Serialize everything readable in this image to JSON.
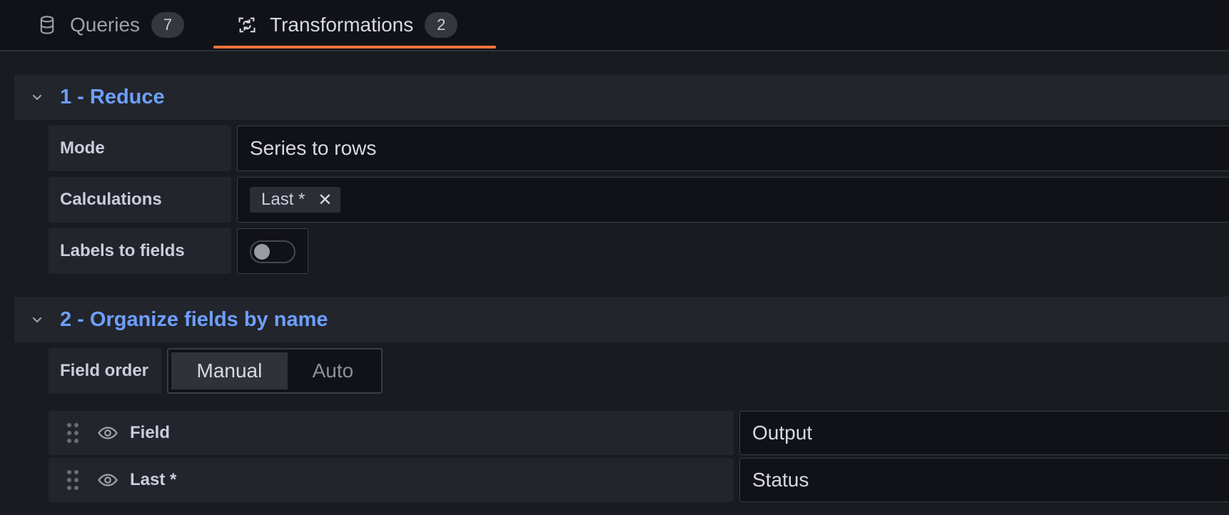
{
  "tabs": [
    {
      "label": "Queries",
      "count": "7",
      "icon": "database-icon"
    },
    {
      "label": "Transformations",
      "count": "2",
      "icon": "transform-icon"
    }
  ],
  "colors": {
    "accent": "#f5733a",
    "section_title": "#6e9fff"
  },
  "transforms": [
    {
      "title": "1 - Reduce",
      "fields": {
        "mode": {
          "label": "Mode",
          "value": "Series to rows"
        },
        "calculations": {
          "label": "Calculations",
          "chips": [
            "Last *"
          ]
        },
        "labels_to_fields": {
          "label": "Labels to fields",
          "enabled": false
        }
      }
    },
    {
      "title": "2 - Organize fields by name",
      "field_order": {
        "label": "Field order",
        "options": [
          "Manual",
          "Auto"
        ],
        "selected": "Manual"
      },
      "rows": [
        {
          "name": "Field",
          "rename": "Output"
        },
        {
          "name": "Last *",
          "rename": "Status"
        }
      ]
    }
  ]
}
